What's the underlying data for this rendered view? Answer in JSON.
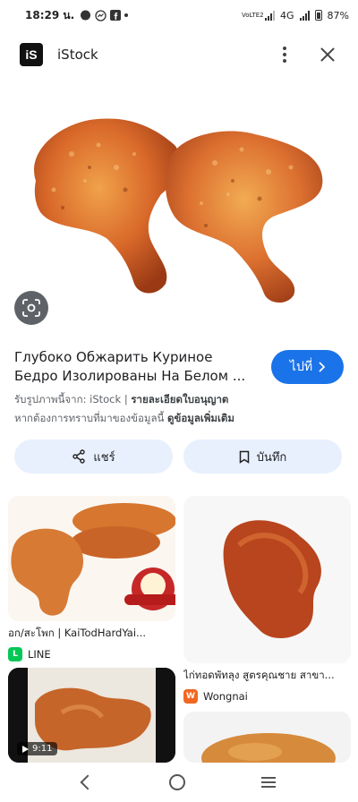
{
  "status_bar": {
    "time": "18:29 น.",
    "network": "4G",
    "volte": "VoLTE2",
    "battery": "87%"
  },
  "header": {
    "logo_text": "iS",
    "site_name": "iStock"
  },
  "hero": {
    "title": "Глубоко Обжарить Куриное Бедро Изолированы На Белом ...",
    "visit_button": "ไปที่"
  },
  "meta": {
    "source_prefix": "รับรูปภาพนี้จาก: iStock",
    "separator": "|",
    "license_link": "รายละเอียดใบอนุญาต",
    "notice_text": "หากต้องการทราบที่มาของข้อมูลนี้",
    "more_link": "ดูข้อมูลเพิ่มเติม"
  },
  "actions": {
    "share_label": "แชร์",
    "save_label": "บันทึก"
  },
  "results": [
    {
      "caption": "อก/สะโพก | KaiTodHardYai...",
      "source": "LINE",
      "source_color": "#06c755",
      "source_icon": "L"
    },
    {
      "caption": "ไก่ทอดพัทลุง สูตรคุณชาย สาขา...",
      "source": "Wongnai",
      "source_color": "#f26722",
      "source_icon": "W"
    },
    {
      "duration": "9:11"
    }
  ],
  "colors": {
    "accent": "#1a73e8",
    "chip_bg": "#e8f0fe"
  },
  "icons": {
    "lens": "lens-icon",
    "share": "share-icon",
    "bookmark": "bookmark-icon",
    "chevron": "chevron-right-icon",
    "play": "play-icon"
  }
}
